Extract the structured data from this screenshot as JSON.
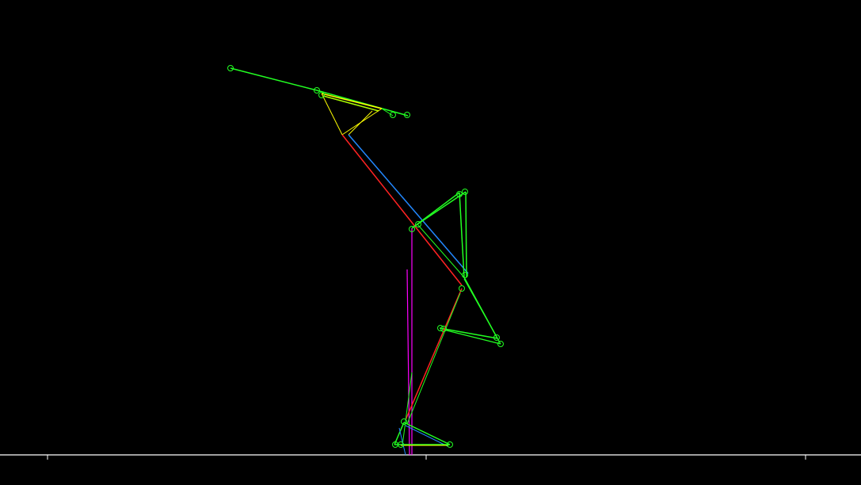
{
  "scene": {
    "background": "#000000",
    "colors": {
      "ground": "#ffffff",
      "joint": "#22ff22",
      "limb_green": "#22ff22",
      "yellow": "#ffff00",
      "lime": "#aaff00",
      "blue": "#2288ff",
      "red": "#ff2222",
      "magenta": "#ff00ff"
    },
    "joint_marker": "circle-icon"
  }
}
